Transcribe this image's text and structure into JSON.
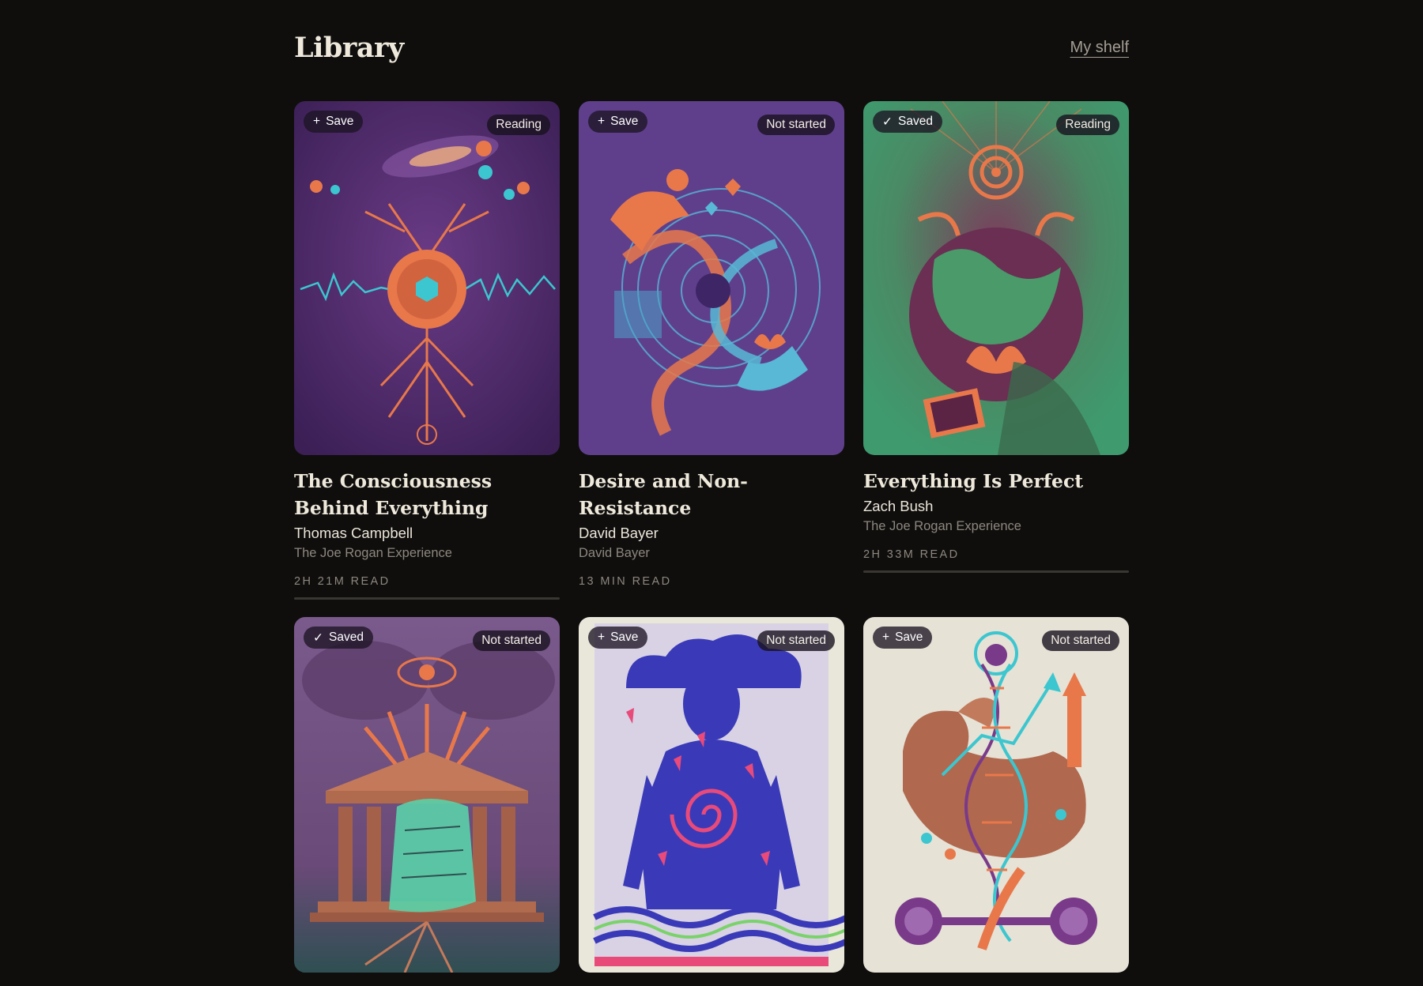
{
  "header": {
    "title": "Library",
    "shelf_link": "My shelf"
  },
  "books": [
    {
      "title": "The Consciousness Behind Everything",
      "author": "Thomas Campbell",
      "podcast": "The Joe Rogan Experience",
      "read_time": "2H 21M READ",
      "status": "Reading",
      "save_label": "Save",
      "save_icon": "+",
      "saved": false,
      "progress_bar": true,
      "cover_icon": "brain-tree-cover-art"
    },
    {
      "title": "Desire and Non-Resistance",
      "author": "David Bayer",
      "podcast": "David Bayer",
      "read_time": "13 MIN READ",
      "status": "Not started",
      "save_label": "Save",
      "save_icon": "+",
      "saved": false,
      "progress_bar": false,
      "cover_icon": "hands-swirl-cover-art"
    },
    {
      "title": "Everything Is Perfect",
      "author": "Zach Bush",
      "podcast": "The Joe Rogan Experience",
      "read_time": "2H 33M READ",
      "status": "Reading",
      "save_label": "Saved",
      "save_icon": "✓",
      "saved": true,
      "progress_bar": true,
      "cover_icon": "earth-lotus-cover-art"
    },
    {
      "status": "Not started",
      "save_label": "Saved",
      "save_icon": "✓",
      "saved": true,
      "cover_icon": "temple-ai-cover-art"
    },
    {
      "status": "Not started",
      "save_label": "Save",
      "save_icon": "+",
      "saved": false,
      "cover_icon": "body-spiral-cover-art"
    },
    {
      "status": "Not started",
      "save_label": "Save",
      "save_icon": "+",
      "saved": false,
      "cover_icon": "muscle-dna-cover-art"
    }
  ],
  "colors": {
    "background": "#0f0e0d",
    "text_primary": "#efe9dc",
    "text_muted": "#8d877e",
    "cover_purple": "#4a2a68",
    "cover_violet": "#5f3f8c",
    "cover_green": "#3f9a6e",
    "accent_orange": "#e8784a",
    "accent_cyan": "#3cc6cf"
  }
}
